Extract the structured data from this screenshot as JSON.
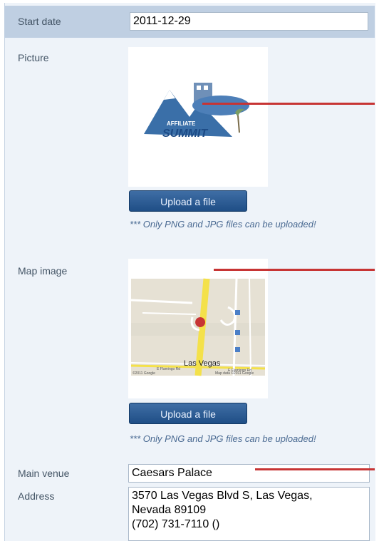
{
  "start_date": {
    "label": "Start date",
    "value": "2011-12-29"
  },
  "picture": {
    "label": "Picture",
    "logo_text_small": "AFFILIATE",
    "logo_text": "SUMMIT",
    "upload_label": "Upload a file",
    "note": "*** Only PNG and JPG files can be uploaded!"
  },
  "map_image": {
    "label": "Map image",
    "map_city": "Las Vegas",
    "map_street1": "E Flamingo Rd",
    "map_street2": "E Flamingo Rd",
    "map_copyright": "©2011 Google",
    "map_data": "Map data ©2011 Google",
    "upload_label": "Upload a file",
    "note": "*** Only PNG and JPG files can be uploaded!"
  },
  "main_venue": {
    "label": "Main venue",
    "value": "Caesars Palace"
  },
  "address": {
    "label": "Address",
    "line1": "3570 Las Vegas Blvd S, Las Vegas,",
    "line2": "Nevada 89109",
    "line3": "(702) 731-7110 ()"
  },
  "colors": {
    "accent": "#1f4e86",
    "annotation": "#c73434",
    "header_row": "#bfcfe2"
  }
}
